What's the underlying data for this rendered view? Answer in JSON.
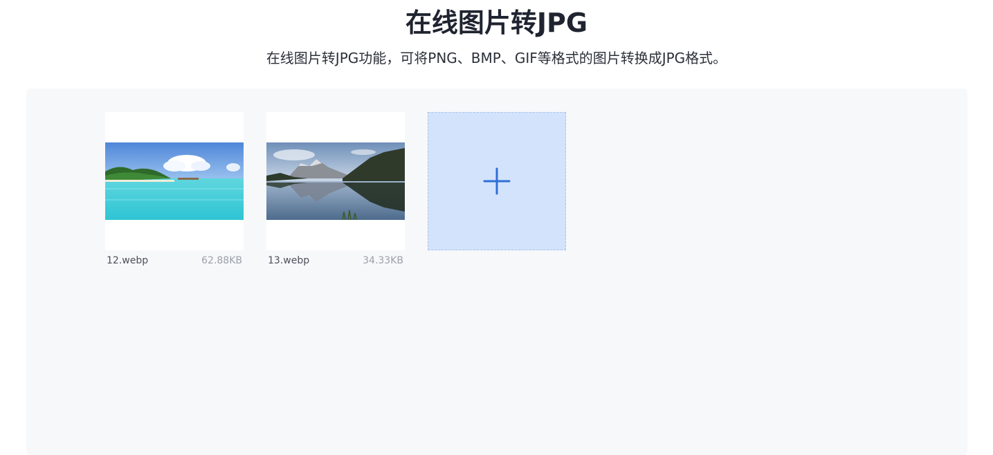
{
  "header": {
    "title": "在线图片转JPG",
    "subtitle": "在线图片转JPG功能，可将PNG、BMP、GIF等格式的图片转换成JPG格式。"
  },
  "files": [
    {
      "name": "12.webp",
      "size": "62.88KB",
      "thumbnail": "tropical-beach-photo"
    },
    {
      "name": "13.webp",
      "size": "34.33KB",
      "thumbnail": "mountain-lake-reflection-photo"
    }
  ],
  "add_tile": {
    "icon": "plus-icon"
  },
  "colors": {
    "title": "#1f2430",
    "workspace_bg": "#f7f8fa",
    "add_tile_bg": "#d3e3fb",
    "accent": "#2f6fd6"
  }
}
